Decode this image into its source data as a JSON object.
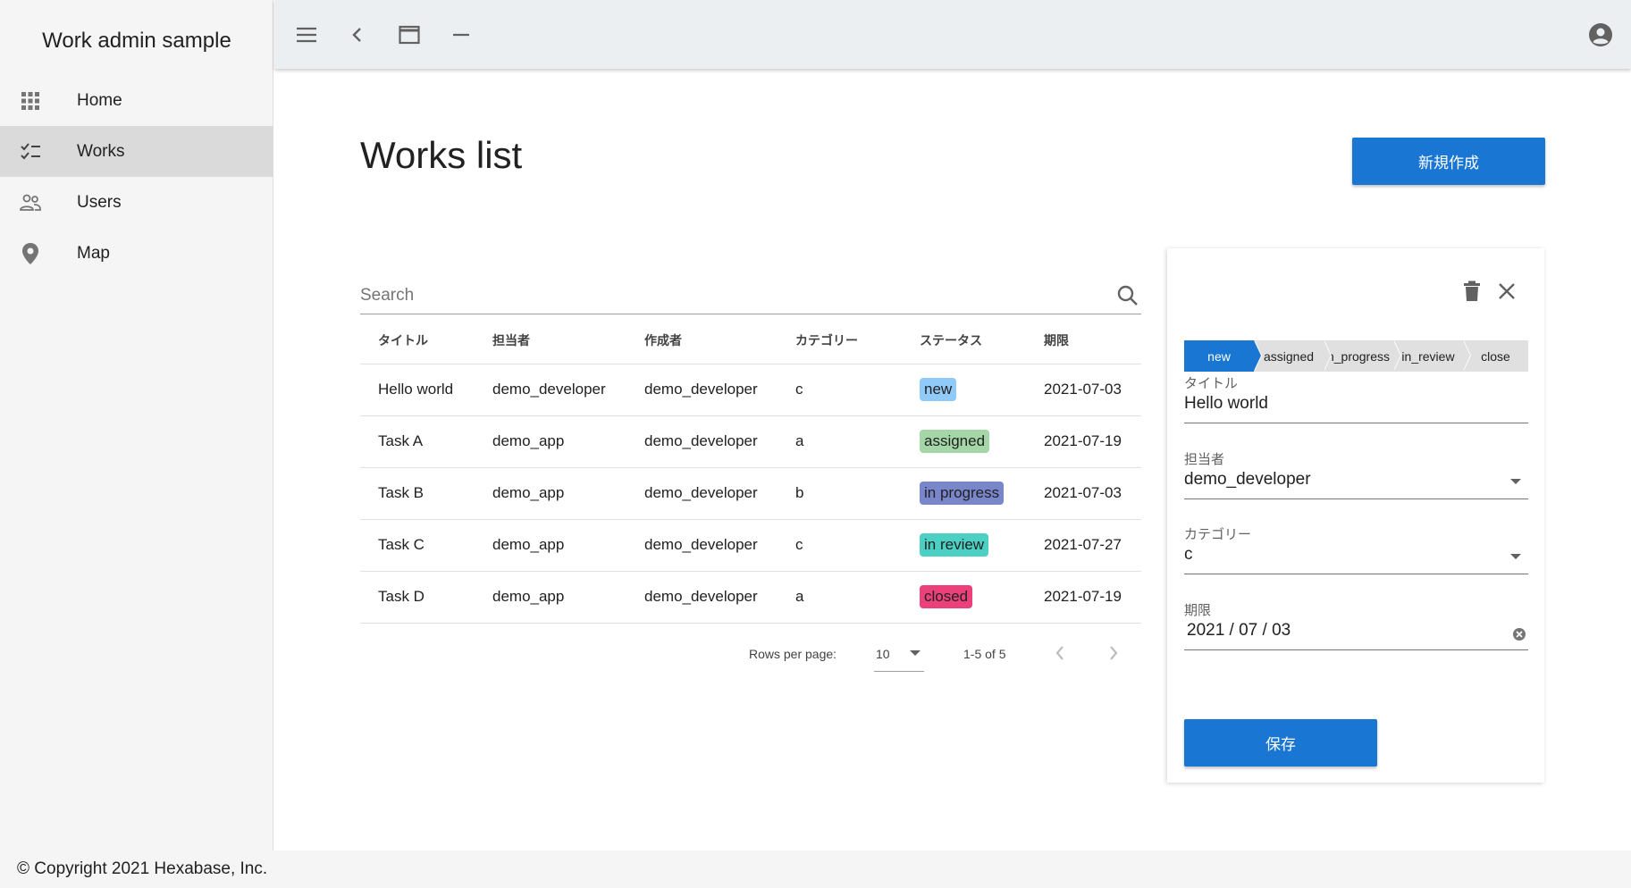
{
  "app": {
    "title": "Work admin sample"
  },
  "sidebar": {
    "items": [
      {
        "label": "Home",
        "icon": "apps-grid-icon",
        "active": false
      },
      {
        "label": "Works",
        "icon": "checklist-icon",
        "active": true
      },
      {
        "label": "Users",
        "icon": "people-icon",
        "active": false
      },
      {
        "label": "Map",
        "icon": "map-pin-icon",
        "active": false
      }
    ]
  },
  "topbar": {
    "icons": [
      "menu-icon",
      "chevron-left-icon",
      "window-maximize-icon",
      "minimize-icon",
      "account-circle-icon"
    ]
  },
  "main": {
    "title": "Works list",
    "new_button": "新規作成",
    "search": {
      "placeholder": "Search"
    },
    "table": {
      "headers": [
        "タイトル",
        "担当者",
        "作成者",
        "カテゴリー",
        "ステータス",
        "期限"
      ],
      "rows": [
        {
          "title": "Hello world",
          "assignee": "demo_developer",
          "creator": "demo_developer",
          "category": "c",
          "status": "new",
          "status_color": "#90caf9",
          "deadline": "2021-07-03"
        },
        {
          "title": "Task A",
          "assignee": "demo_app",
          "creator": "demo_developer",
          "category": "a",
          "status": "assigned",
          "status_color": "#a5d6a7",
          "deadline": "2021-07-19"
        },
        {
          "title": "Task B",
          "assignee": "demo_app",
          "creator": "demo_developer",
          "category": "b",
          "status": "in progress",
          "status_color": "#7986cb",
          "deadline": "2021-07-03"
        },
        {
          "title": "Task C",
          "assignee": "demo_app",
          "creator": "demo_developer",
          "category": "c",
          "status": "in review",
          "status_color": "#4dd0c4",
          "deadline": "2021-07-27"
        },
        {
          "title": "Task D",
          "assignee": "demo_app",
          "creator": "demo_developer",
          "category": "a",
          "status": "closed",
          "status_color": "#ec407a",
          "deadline": "2021-07-19"
        }
      ]
    },
    "pagination": {
      "rows_per_page_label": "Rows per page:",
      "rows_per_page_value": "10",
      "range": "1-5 of 5"
    }
  },
  "panel": {
    "steps": [
      "new",
      "assigned",
      "n_progress",
      "in_review",
      "close"
    ],
    "active_step": 0,
    "fields": {
      "title": {
        "label": "タイトル",
        "value": "Hello world"
      },
      "assignee": {
        "label": "担当者",
        "value": "demo_developer"
      },
      "category": {
        "label": "カテゴリー",
        "value": "c"
      },
      "deadline": {
        "label": "期限",
        "value": "2021 / 07 / 03"
      }
    },
    "save_button": "保存"
  },
  "footer": {
    "copyright": "© Copyright 2021 Hexabase, Inc."
  },
  "colors": {
    "primary": "#1976d2",
    "sidebar_bg": "#f5f5f5",
    "topbar_bg": "#eceff1",
    "active_nav_bg": "#dadada"
  }
}
